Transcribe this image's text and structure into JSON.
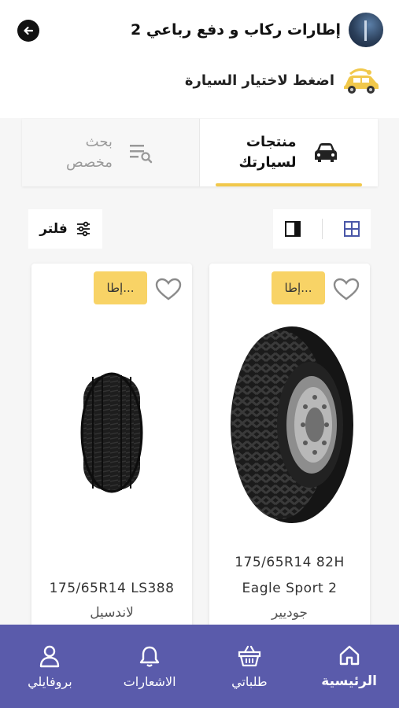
{
  "header": {
    "category_title": "إطارات ركاب و دفع رباعي 2",
    "car_select_label": "اضغط لاختيار السيارة"
  },
  "tabs": [
    {
      "label_line1": "منتجات",
      "label_line2": "لسيارتك",
      "active": true
    },
    {
      "label_line1": "بحث",
      "label_line2": "مخصص",
      "active": false
    }
  ],
  "toolbar": {
    "filter_label": "فلتر"
  },
  "products": [
    {
      "badge": "إطا...",
      "name_line1": "175/65R14  82H",
      "name_line2": "Eagle Sport 2",
      "brand": "جوديير"
    },
    {
      "badge": "إطا...",
      "name_line1": "175/65R14 LS388",
      "brand": "لاندسيل"
    }
  ],
  "bottom_nav": [
    {
      "label": "الرئيسية",
      "icon": "home-icon",
      "active": true
    },
    {
      "label": "طلباتي",
      "icon": "basket-icon",
      "active": false
    },
    {
      "label": "الاشعارات",
      "icon": "bell-icon",
      "active": false
    },
    {
      "label": "بروفايلي",
      "icon": "profile-icon",
      "active": false
    }
  ],
  "colors": {
    "accent_yellow": "#f1c84b",
    "badge_yellow": "#f8d366",
    "nav_purple": "#5a5bab",
    "grid_icon_blue": "#4a57a8"
  }
}
